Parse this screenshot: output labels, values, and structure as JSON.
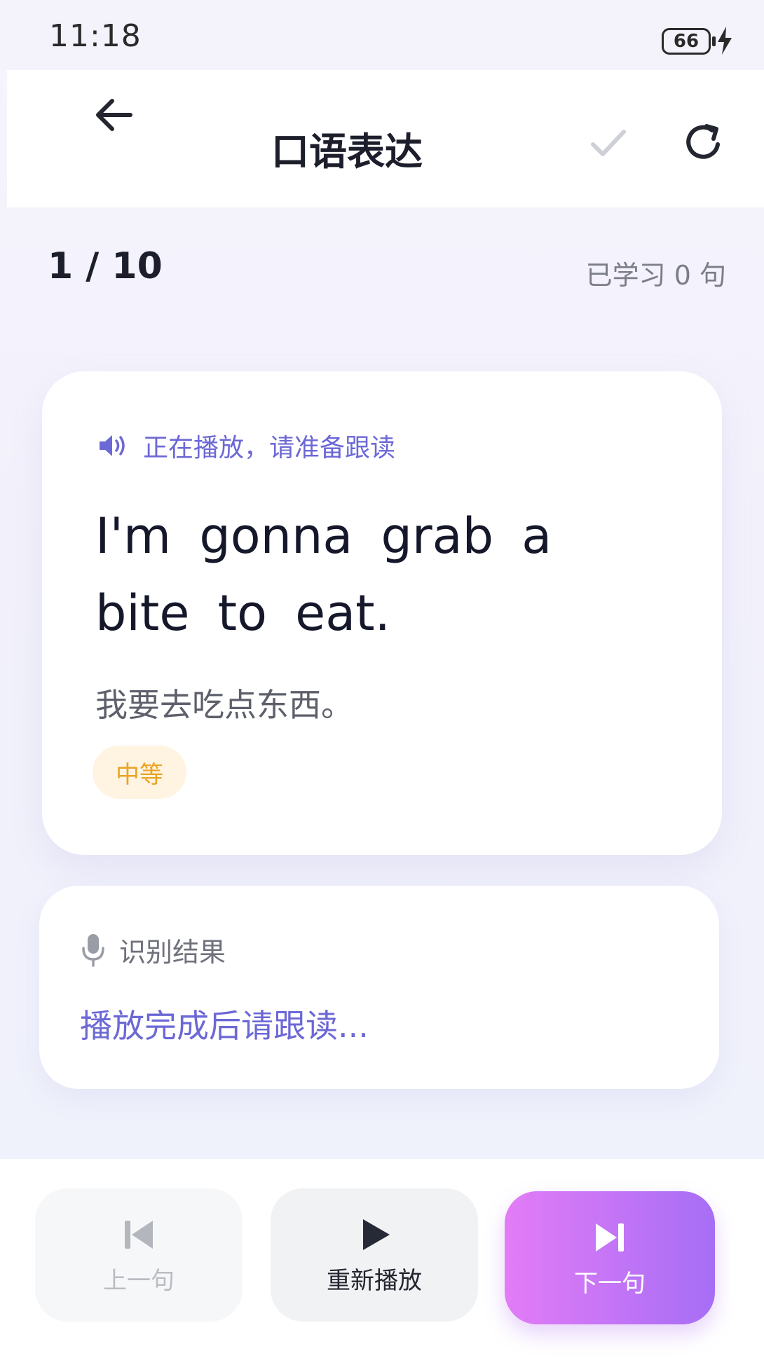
{
  "status_bar": {
    "time": "11:18",
    "battery": "66"
  },
  "app_bar": {
    "title": "口语表达",
    "icons": [
      "arrow-left-icon",
      "checkmark-icon",
      "refresh-icon"
    ]
  },
  "progress": {
    "current": "1 / 10",
    "learned": "已学习 0 句"
  },
  "sentence_card": {
    "status": "正在播放，请准备跟读",
    "sentence": "I'm gonna grab a bite to eat.",
    "translation": "我要去吃点东西。",
    "difficulty": "中等"
  },
  "result_card": {
    "title": "识别结果",
    "hint": "播放完成后请跟读..."
  },
  "controls": {
    "prev_label": "上一句",
    "replay_label": "重新播放",
    "next_label": "下一句"
  },
  "colors": {
    "accent": "#6c68d6",
    "difficulty_text": "#e9a327",
    "difficulty_bg": "#fff4e2",
    "next_gradient_start": "#e37cf6",
    "next_gradient_end": "#a66ef5"
  }
}
